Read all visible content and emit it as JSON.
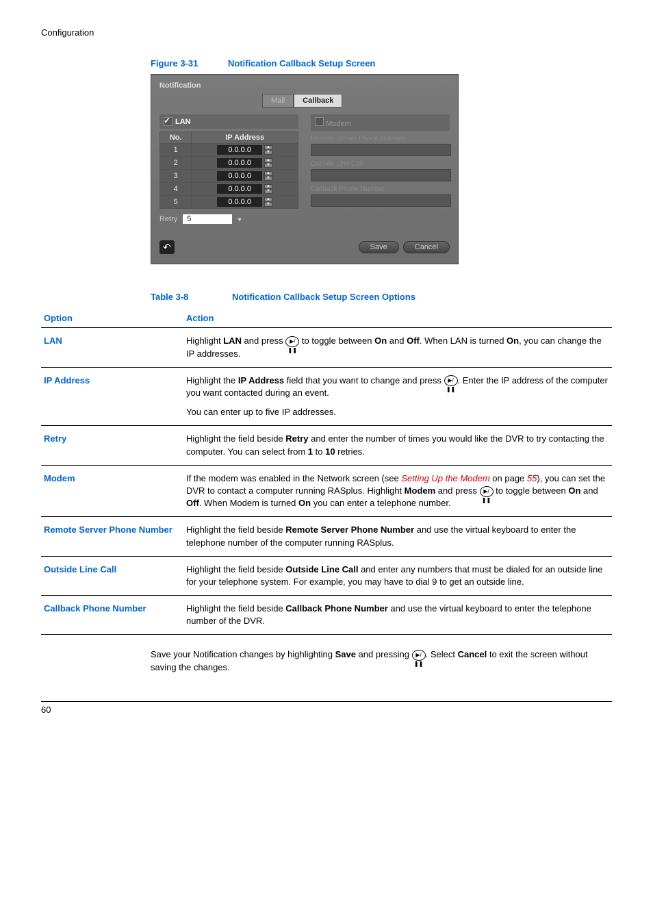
{
  "section_header": "Configuration",
  "figure": {
    "label": "Figure 3-31",
    "title": "Notification Callback Setup Screen"
  },
  "screenshot": {
    "title": "Notification",
    "tab_inactive": "Mail",
    "tab_active": "Callback",
    "lan": {
      "label": "LAN",
      "checked": true,
      "col_no": "No.",
      "col_ip": "IP Address",
      "rows": [
        {
          "no": "1",
          "ip": "0.0.0.0"
        },
        {
          "no": "2",
          "ip": "0.0.0.0"
        },
        {
          "no": "3",
          "ip": "0.0.0.0"
        },
        {
          "no": "4",
          "ip": "0.0.0.0"
        },
        {
          "no": "5",
          "ip": "0.0.0.0"
        }
      ],
      "retry_label": "Retry",
      "retry_value": "5"
    },
    "modem": {
      "label": "Modem",
      "field1": "Remote Server Phone Number",
      "field2": "Outside Line Call",
      "field3": "Callback Phone Number"
    },
    "save": "Save",
    "cancel": "Cancel"
  },
  "table": {
    "label": "Table 3-8",
    "title": "Notification Callback Setup Screen Options",
    "header_option": "Option",
    "header_action": "Action",
    "rows": {
      "lan": {
        "name": "LAN",
        "a1": "Highlight ",
        "a2": "LAN",
        "a3": " and press ",
        "a4": " to toggle between ",
        "a5": "On",
        "a6": " and ",
        "a7": "Off",
        "a8": ". When LAN is turned ",
        "a9": "On",
        "a10": ", you can change the IP addresses."
      },
      "ip": {
        "name": "IP Address",
        "a1": "Highlight the ",
        "a2": "IP Address",
        "a3": " field that you want to change and press ",
        "a4": ". Enter the IP address of the computer you want contacted during an event.",
        "b": "You can enter up to five IP addresses."
      },
      "retry": {
        "name": "Retry",
        "a1": "Highlight the field beside ",
        "a2": "Retry",
        "a3": " and enter the number of times you would like the DVR to try contacting the computer. You can select from ",
        "a4": "1",
        "a5": " to ",
        "a6": "10",
        "a7": " retries."
      },
      "modem": {
        "name": "Modem",
        "a1": "If the modem was enabled in the Network screen (see ",
        "link1": "Setting Up the Modem",
        "a2": " on page ",
        "link2": "55",
        "a3": "), you can set the DVR to contact a computer running RASplus. Highlight ",
        "a4": "Modem",
        "a5": " and press ",
        "a6": " to toggle between ",
        "a7": "On",
        "a8": " and ",
        "a9": "Off",
        "a10": ". When Modem is turned ",
        "a11": "On",
        "a12": " you can enter a telephone number."
      },
      "remote": {
        "name": "Remote Server Phone Number",
        "a1": "Highlight the field beside ",
        "a2": "Remote Server Phone Number",
        "a3": " and use the virtual keyboard to enter the telephone number of the computer running RASplus."
      },
      "outside": {
        "name": "Outside Line Call",
        "a1": "Highlight the field beside ",
        "a2": "Outside Line Call",
        "a3": " and enter any numbers that must be dialed for an outside line for your telephone system. For example, you may have to dial 9 to get an outside line."
      },
      "callback": {
        "name": "Callback Phone Number",
        "a1": "Highlight the field beside ",
        "a2": "Callback Phone Number",
        "a3": " and use the virtual keyboard to enter the telephone number of the DVR."
      }
    }
  },
  "footer_para": {
    "a1": "Save your Notification changes by highlighting ",
    "a2": "Save",
    "a3": " and pressing ",
    "a4": ". Select ",
    "a5": "Cancel",
    "a6": " to exit the screen without saving the changes."
  },
  "page_number": "60",
  "icon_glyph": "▶/❚❚"
}
